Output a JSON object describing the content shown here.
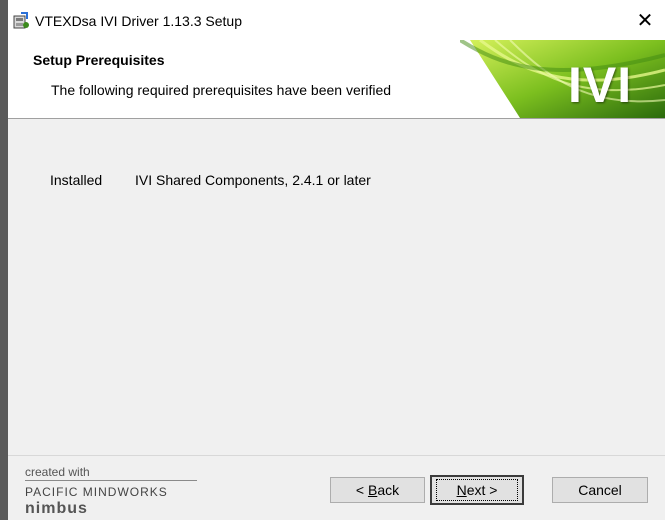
{
  "window": {
    "title": "VTEXDsa IVI Driver 1.13.3 Setup",
    "close_glyph": "✕"
  },
  "banner": {
    "title": "Setup Prerequisites",
    "subtitle": "The following required prerequisites have been verified",
    "logo_text": "IVI",
    "logo_colors": {
      "dark": "#2f6e0a",
      "light": "#c5e84a"
    }
  },
  "prerequisites": [
    {
      "status": "Installed",
      "name": "IVI Shared Components, 2.4.1 or later"
    }
  ],
  "branding": {
    "created_with": "created with",
    "company": "PACIFIC MINDWORKS",
    "product": "nimbus"
  },
  "buttons": {
    "back": {
      "prefix": "< ",
      "mnemonic": "B",
      "rest": "ack"
    },
    "next": {
      "mnemonic": "N",
      "rest": "ext >"
    },
    "cancel": "Cancel"
  },
  "icons": {
    "app": "installer-icon",
    "close": "close-icon"
  }
}
